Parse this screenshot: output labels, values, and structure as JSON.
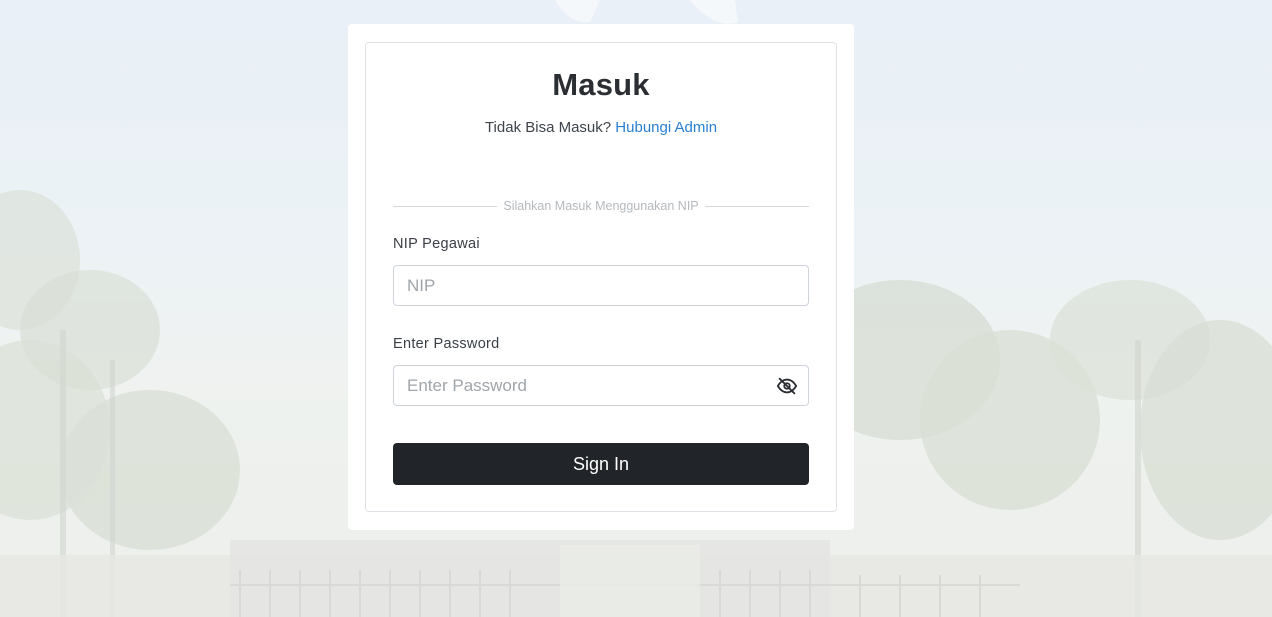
{
  "login": {
    "title": "Masuk",
    "subtitle_text": "Tidak Bisa Masuk?",
    "subtitle_link": "Hubungi Admin",
    "divider_text": "Silahkan Masuk Menggunakan NIP",
    "nip_label": "NIP Pegawai",
    "nip_placeholder": "NIP",
    "password_label": "Enter Password",
    "password_placeholder": "Enter Password",
    "toggle_icon": "eye-slash-icon",
    "submit_label": "Sign In"
  },
  "colors": {
    "link": "#2a7fd3",
    "button_bg": "#212529",
    "button_text": "#ffffff",
    "card_bg": "#ffffff"
  }
}
